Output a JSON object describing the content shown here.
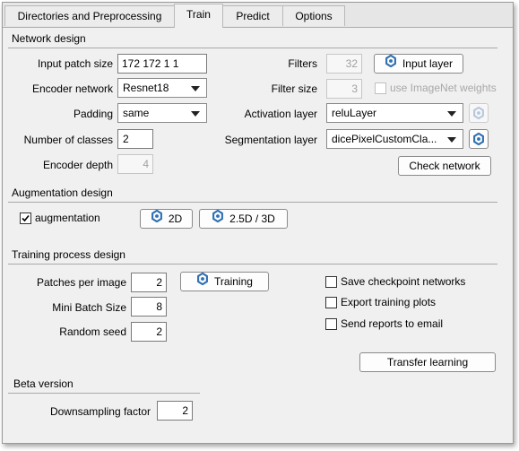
{
  "tabs": [
    "Directories and Preprocessing",
    "Train",
    "Predict",
    "Options"
  ],
  "active_tab": "Train",
  "colors": {
    "icon_blue": "#2e6fb3",
    "icon_disabled": "#b8c8dc"
  },
  "network_design": {
    "title": "Network design",
    "input_patch_size_label": "Input patch size",
    "input_patch_size_value": "172 172 1 1",
    "encoder_network_label": "Encoder network",
    "encoder_network_value": "Resnet18",
    "padding_label": "Padding",
    "padding_value": "same",
    "number_of_classes_label": "Number of classes",
    "number_of_classes_value": "2",
    "encoder_depth_label": "Encoder depth",
    "encoder_depth_value": "4",
    "filters_label": "Filters",
    "filters_value": "32",
    "input_layer_button": "Input layer",
    "filter_size_label": "Filter size",
    "filter_size_value": "3",
    "imagenet_weights_label": "use ImageNet weights",
    "activation_layer_label": "Activation layer",
    "activation_layer_value": "reluLayer",
    "segmentation_layer_label": "Segmentation layer",
    "segmentation_layer_value": "dicePixelCustomCla...",
    "check_network_button": "Check network"
  },
  "augmentation_design": {
    "title": "Augmentation design",
    "augmentation_label": "augmentation",
    "augmentation_checked": true,
    "btn_2d": "2D",
    "btn_25d3d": "2.5D / 3D"
  },
  "training_process": {
    "title": "Training process design",
    "patches_per_image_label": "Patches per image",
    "patches_per_image_value": "2",
    "mini_batch_size_label": "Mini Batch Size",
    "mini_batch_size_value": "8",
    "random_seed_label": "Random seed",
    "random_seed_value": "2",
    "training_button": "Training",
    "save_checkpoint_label": "Save checkpoint networks",
    "export_plots_label": "Export training plots",
    "send_reports_label": "Send reports to email",
    "transfer_learning_button": "Transfer learning"
  },
  "beta_version": {
    "title": "Beta version",
    "downsampling_factor_label": "Downsampling factor",
    "downsampling_factor_value": "2"
  }
}
